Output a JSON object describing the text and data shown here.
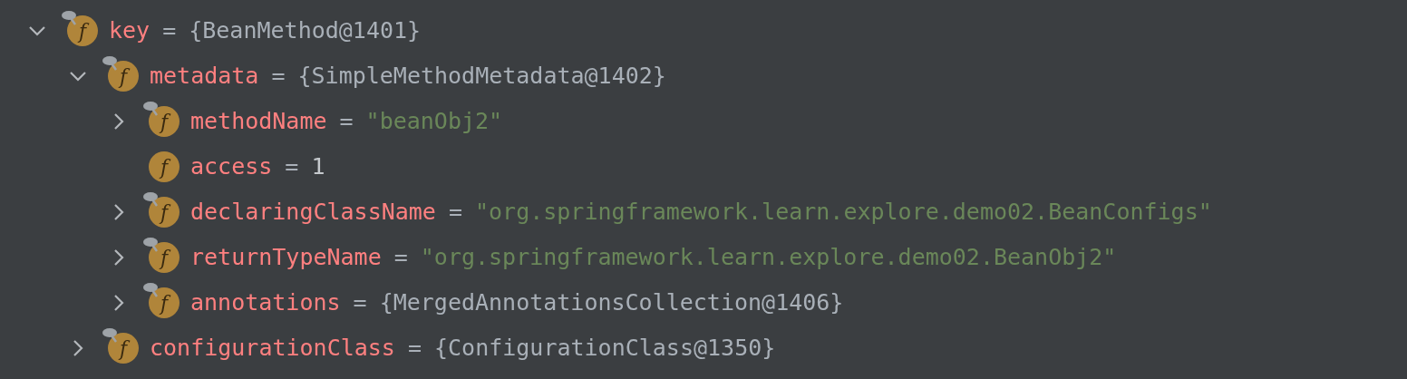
{
  "tree": [
    {
      "badge": "f",
      "pinned": true,
      "name": "key",
      "operator": "=",
      "value": "{BeanMethod@1401}",
      "kind": "object",
      "expandable": true,
      "expanded": true,
      "children": [
        {
          "badge": "f",
          "pinned": true,
          "name": "metadata",
          "operator": "=",
          "value": "{SimpleMethodMetadata@1402}",
          "kind": "object",
          "expandable": true,
          "expanded": true,
          "children": [
            {
              "badge": "f",
              "pinned": true,
              "name": "methodName",
              "operator": "=",
              "value": "\"beanObj2\"",
              "kind": "string",
              "expandable": true,
              "expanded": false
            },
            {
              "badge": "f",
              "pinned": false,
              "name": "access",
              "operator": "=",
              "value": "1",
              "kind": "number",
              "expandable": false
            },
            {
              "badge": "f",
              "pinned": true,
              "name": "declaringClassName",
              "operator": "=",
              "value": "\"org.springframework.learn.explore.demo02.BeanConfigs\"",
              "kind": "string",
              "expandable": true,
              "expanded": false
            },
            {
              "badge": "f",
              "pinned": true,
              "name": "returnTypeName",
              "operator": "=",
              "value": "\"org.springframework.learn.explore.demo02.BeanObj2\"",
              "kind": "string",
              "expandable": true,
              "expanded": false
            },
            {
              "badge": "f",
              "pinned": true,
              "name": "annotations",
              "operator": "=",
              "value": "{MergedAnnotationsCollection@1406}",
              "kind": "object",
              "expandable": true,
              "expanded": false
            }
          ]
        },
        {
          "badge": "f",
          "pinned": true,
          "name": "configurationClass",
          "operator": "=",
          "value": "{ConfigurationClass@1350}",
          "kind": "object",
          "expandable": true,
          "expanded": false
        }
      ]
    }
  ]
}
